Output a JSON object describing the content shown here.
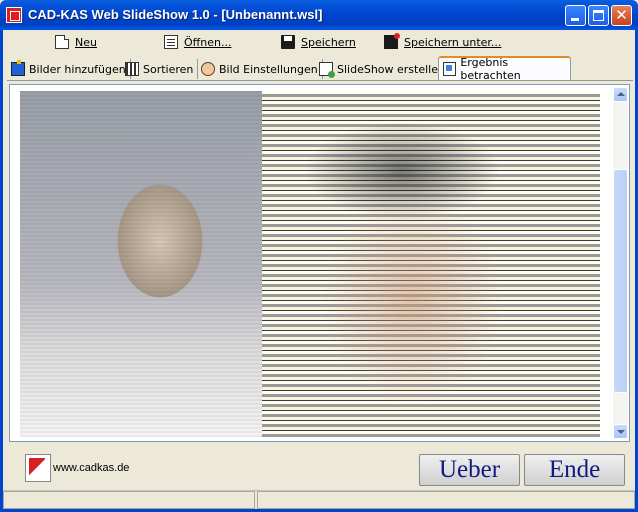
{
  "window": {
    "title": "CAD-KAS Web SlideShow 1.0 - [Unbenannt.wsl]",
    "app_icon": "cadkas-icon"
  },
  "toolbar": {
    "new_label": "Neu",
    "open_label": "Öffnen...",
    "save_label": "Speichern",
    "save_as_label": "Speichern unter..."
  },
  "tabs": [
    {
      "label": "Bilder hinzufügen",
      "icon": "add-images-icon",
      "active": false
    },
    {
      "label": "Sortieren",
      "icon": "sort-icon",
      "active": false
    },
    {
      "label": "Bild Einstellungen",
      "icon": "image-settings-icon",
      "active": false
    },
    {
      "label": "SlideShow erstellen",
      "icon": "create-slideshow-icon",
      "active": false
    },
    {
      "label": "Ergebnis betrachten",
      "icon": "view-result-icon",
      "active": true
    }
  ],
  "preview": {
    "content": "slideshow transition preview: two photos of faces with blinds effect"
  },
  "footer": {
    "url": "www.cadkas.de",
    "about_label": "Ueber",
    "exit_label": "Ende"
  },
  "colors": {
    "titlebar": "#0045cf",
    "button_text": "#121a80",
    "active_tab_accent": "#e68b2c"
  }
}
